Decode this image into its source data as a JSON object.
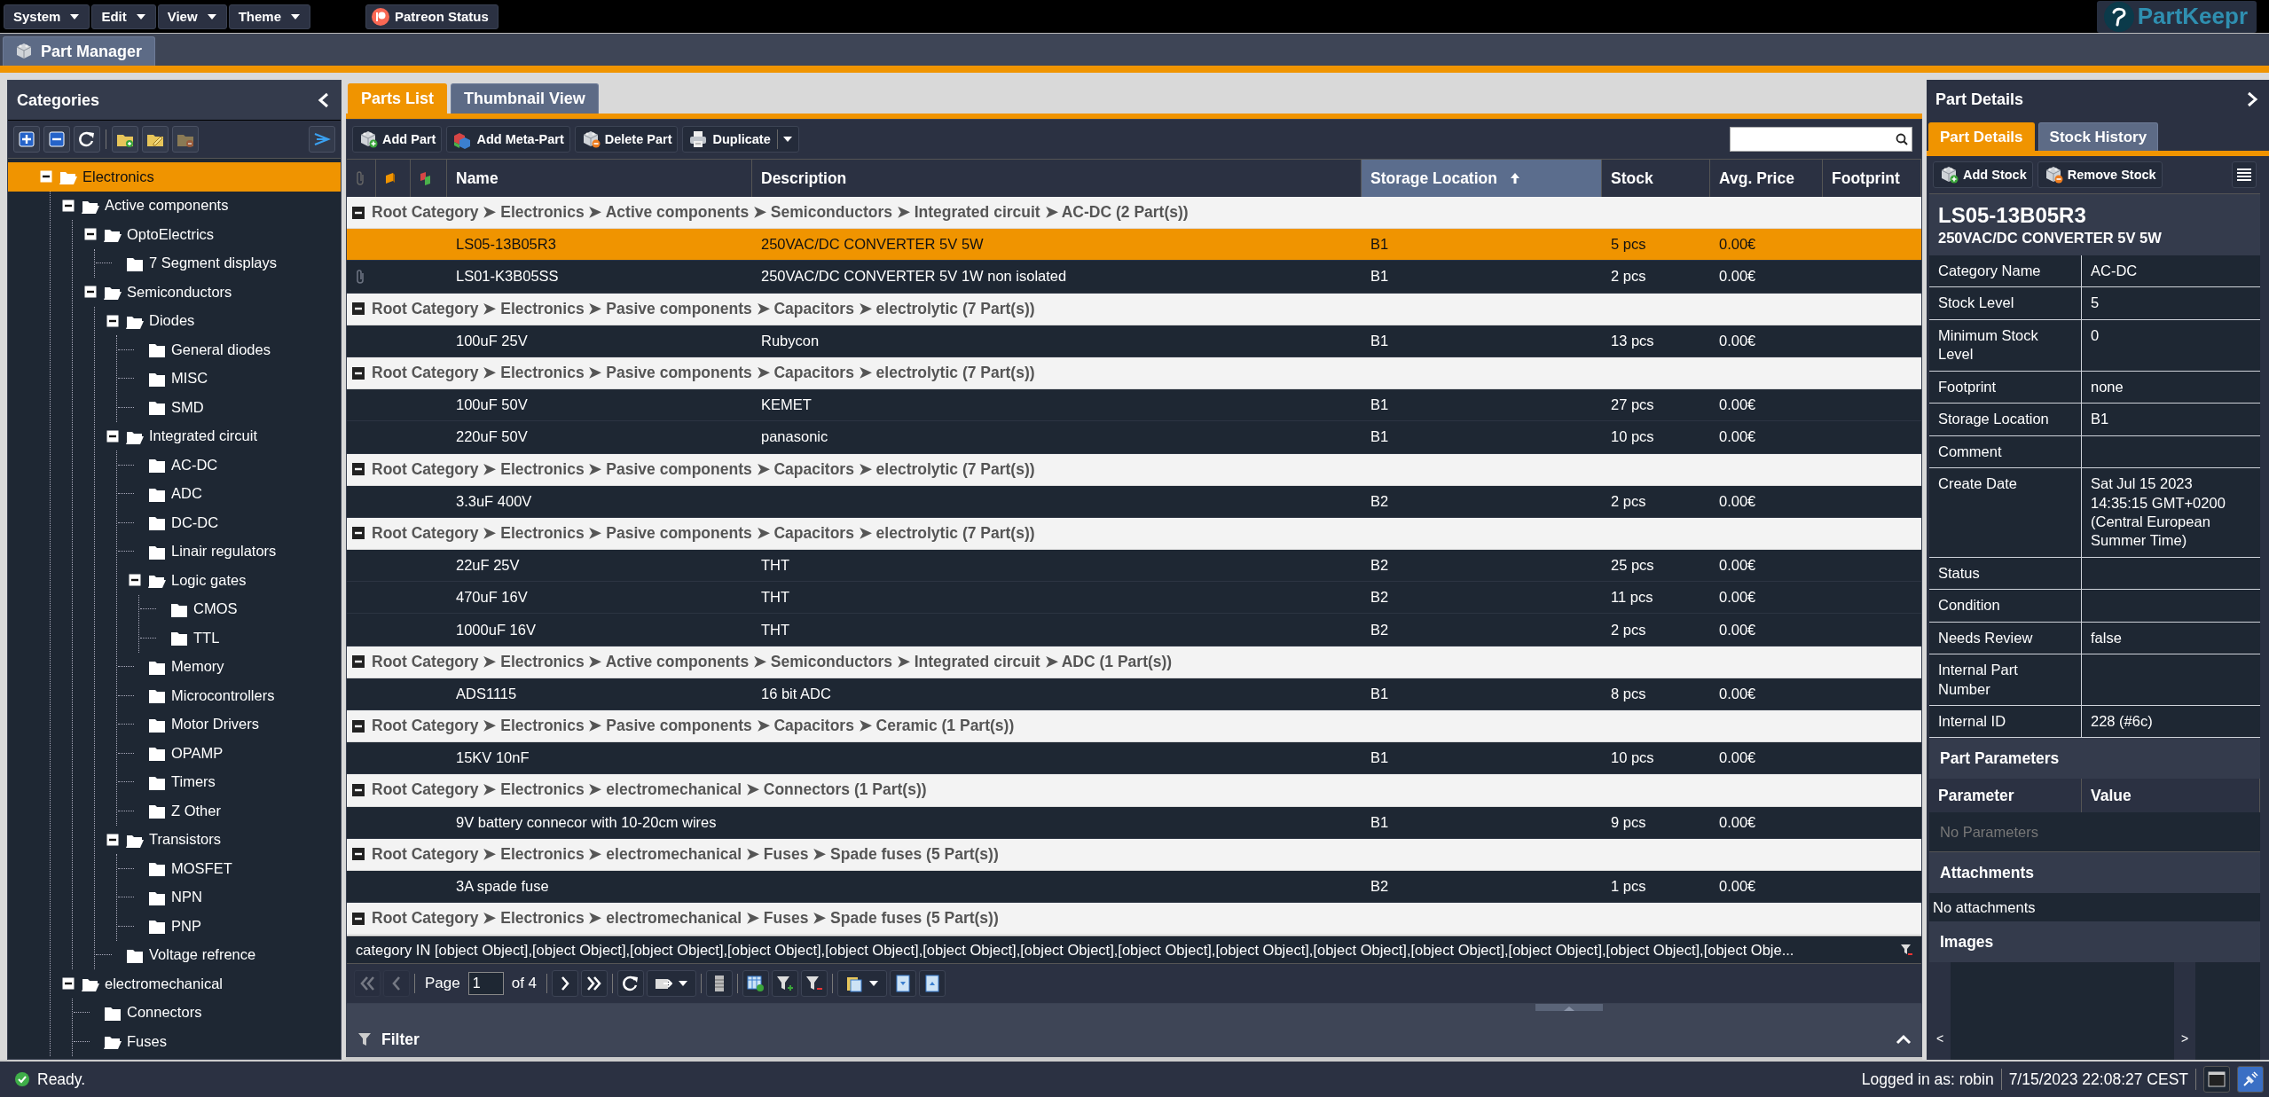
{
  "menus": [
    {
      "label": "System"
    },
    {
      "label": "Edit"
    },
    {
      "label": "View"
    },
    {
      "label": "Theme"
    }
  ],
  "patreon_button": "Patreon Status",
  "logo": "PartKeepr",
  "app_tabs": [
    {
      "label": "Part Manager",
      "selected": true
    }
  ],
  "categories": {
    "title": "Categories",
    "tree": [
      {
        "label": "Electronics",
        "selected": true,
        "expanded": true,
        "children": [
          {
            "label": "Active components",
            "selected": false,
            "expanded": true,
            "children": [
              {
                "label": "OptoElectrics",
                "selected": false,
                "expanded": true,
                "children": [
                  {
                    "label": "7 Segment displays",
                    "selected": false,
                    "expanded": false
                  }
                ]
              },
              {
                "label": "Semiconductors",
                "selected": false,
                "expanded": true,
                "children": [
                  {
                    "label": "Diodes",
                    "selected": false,
                    "expanded": true,
                    "children": [
                      {
                        "label": "General diodes",
                        "selected": false,
                        "expanded": false
                      },
                      {
                        "label": "MISC",
                        "selected": false,
                        "expanded": false
                      },
                      {
                        "label": "SMD",
                        "selected": false,
                        "expanded": false
                      }
                    ]
                  },
                  {
                    "label": "Integrated circuit",
                    "selected": false,
                    "expanded": true,
                    "children": [
                      {
                        "label": "AC-DC",
                        "selected": false,
                        "expanded": false
                      },
                      {
                        "label": "ADC",
                        "selected": false,
                        "expanded": false
                      },
                      {
                        "label": "DC-DC",
                        "selected": false,
                        "expanded": false
                      },
                      {
                        "label": "Linair regulators",
                        "selected": false,
                        "expanded": false
                      },
                      {
                        "label": "Logic gates",
                        "selected": false,
                        "expanded": true,
                        "children": [
                          {
                            "label": "CMOS",
                            "selected": false,
                            "expanded": false
                          },
                          {
                            "label": "TTL",
                            "selected": false,
                            "expanded": false
                          }
                        ]
                      },
                      {
                        "label": "Memory",
                        "selected": false,
                        "expanded": false
                      },
                      {
                        "label": "Microcontrollers",
                        "selected": false,
                        "expanded": false
                      },
                      {
                        "label": "Motor Drivers",
                        "selected": false,
                        "expanded": false
                      },
                      {
                        "label": "OPAMP",
                        "selected": false,
                        "expanded": false
                      },
                      {
                        "label": "Timers",
                        "selected": false,
                        "expanded": false
                      },
                      {
                        "label": "Z Other",
                        "selected": false,
                        "expanded": false
                      }
                    ]
                  },
                  {
                    "label": "Transistors",
                    "selected": false,
                    "expanded": true,
                    "children": [
                      {
                        "label": "MOSFET",
                        "selected": false,
                        "expanded": false
                      },
                      {
                        "label": "NPN",
                        "selected": false,
                        "expanded": false
                      },
                      {
                        "label": "PNP",
                        "selected": false,
                        "expanded": false
                      }
                    ]
                  },
                  {
                    "label": "Voltage refrence",
                    "selected": false,
                    "expanded": false
                  }
                ]
              }
            ]
          },
          {
            "label": "electromechanical",
            "selected": false,
            "expanded": true,
            "children": [
              {
                "label": "Connectors",
                "selected": false,
                "expanded": false
              },
              {
                "label": "Fuses",
                "selected": false,
                "expanded": true
              }
            ]
          }
        ]
      }
    ]
  },
  "parts": {
    "tabs": [
      {
        "label": "Parts List",
        "selected": true
      },
      {
        "label": "Thumbnail View",
        "selected": false
      }
    ],
    "toolbar": [
      {
        "kind": "add",
        "label": "Add Part"
      },
      {
        "kind": "meta",
        "label": "Add Meta-Part"
      },
      {
        "kind": "delete",
        "label": "Delete Part"
      },
      {
        "kind": "duplicate",
        "label": "Duplicate"
      }
    ],
    "columns": [
      {
        "kind": "attachment",
        "sorted": false
      },
      {
        "kind": "tag",
        "sorted": false
      },
      {
        "kind": "meta",
        "sorted": false
      },
      {
        "kind": "text",
        "label": "Name",
        "sorted": false
      },
      {
        "kind": "text",
        "label": "Description",
        "sorted": false
      },
      {
        "kind": "text",
        "label": "Storage Location",
        "sorted": true
      },
      {
        "kind": "text",
        "label": "Stock",
        "sorted": false
      },
      {
        "kind": "text",
        "label": "Avg. Price",
        "sorted": false
      },
      {
        "kind": "text",
        "label": "Footprint",
        "sorted": false
      }
    ],
    "rows": [
      {
        "kind": "group",
        "expanded": true,
        "text": "Root Category ➤ Electronics ➤ Active components ➤ Semiconductors ➤ Integrated circuit ➤ AC-DC (2 Part(s))"
      },
      {
        "kind": "part",
        "selected": true,
        "attachment": false,
        "name": "LS05-13B05R3",
        "description": "250VAC/DC CONVERTER 5V 5W",
        "storage_location": "B1",
        "stock": "5 pcs",
        "avg_price": "0.00€"
      },
      {
        "kind": "part",
        "selected": false,
        "attachment": true,
        "name": "LS01-K3B05SS",
        "description": "250VAC/DC CONVERTER 5V 1W non isolated",
        "storage_location": "B1",
        "stock": "2 pcs",
        "avg_price": "0.00€"
      },
      {
        "kind": "group",
        "expanded": true,
        "text": "Root Category ➤ Electronics ➤ Pasive components ➤ Capacitors ➤ electrolytic (7 Part(s))"
      },
      {
        "kind": "part",
        "selected": false,
        "attachment": false,
        "name": "100uF 25V",
        "description": "Rubycon",
        "storage_location": "B1",
        "stock": "13 pcs",
        "avg_price": "0.00€"
      },
      {
        "kind": "group",
        "expanded": true,
        "text": "Root Category ➤ Electronics ➤ Pasive components ➤ Capacitors ➤ electrolytic (7 Part(s))"
      },
      {
        "kind": "part",
        "selected": false,
        "attachment": false,
        "name": "100uF 50V",
        "description": "KEMET",
        "storage_location": "B1",
        "stock": "27 pcs",
        "avg_price": "0.00€"
      },
      {
        "kind": "part",
        "selected": false,
        "attachment": false,
        "name": "220uF 50V",
        "description": "panasonic",
        "storage_location": "B1",
        "stock": "10 pcs",
        "avg_price": "0.00€"
      },
      {
        "kind": "group",
        "expanded": true,
        "text": "Root Category ➤ Electronics ➤ Pasive components ➤ Capacitors ➤ electrolytic (7 Part(s))"
      },
      {
        "kind": "part",
        "selected": false,
        "attachment": false,
        "name": "3.3uF 400V",
        "storage_location": "B2",
        "stock": "2 pcs",
        "avg_price": "0.00€"
      },
      {
        "kind": "group",
        "expanded": true,
        "text": "Root Category ➤ Electronics ➤ Pasive components ➤ Capacitors ➤ electrolytic (7 Part(s))"
      },
      {
        "kind": "part",
        "selected": false,
        "attachment": false,
        "name": "22uF 25V",
        "description": "THT",
        "storage_location": "B2",
        "stock": "25 pcs",
        "avg_price": "0.00€"
      },
      {
        "kind": "part",
        "selected": false,
        "attachment": false,
        "name": "470uF 16V",
        "description": "THT",
        "storage_location": "B2",
        "stock": "11 pcs",
        "avg_price": "0.00€"
      },
      {
        "kind": "part",
        "selected": false,
        "attachment": false,
        "name": "1000uF 16V",
        "description": "THT",
        "storage_location": "B2",
        "stock": "2 pcs",
        "avg_price": "0.00€"
      },
      {
        "kind": "group",
        "expanded": true,
        "text": "Root Category ➤ Electronics ➤ Active components ➤ Semiconductors ➤ Integrated circuit ➤ ADC (1 Part(s))"
      },
      {
        "kind": "part",
        "selected": false,
        "attachment": false,
        "name": "ADS1115",
        "description": "16 bit ADC",
        "storage_location": "B1",
        "stock": "8 pcs",
        "avg_price": "0.00€"
      },
      {
        "kind": "group",
        "expanded": true,
        "text": "Root Category ➤ Electronics ➤ Pasive components ➤ Capacitors ➤ Ceramic (1 Part(s))"
      },
      {
        "kind": "part",
        "selected": false,
        "attachment": false,
        "name": "15KV 10nF",
        "storage_location": "B1",
        "stock": "10 pcs",
        "avg_price": "0.00€"
      },
      {
        "kind": "group",
        "expanded": true,
        "text": "Root Category ➤ Electronics ➤ electromechanical ➤ Connectors (1 Part(s))"
      },
      {
        "kind": "part",
        "selected": false,
        "attachment": false,
        "name": "9V battery connecor with 10-20cm wires",
        "storage_location": "B1",
        "stock": "9 pcs",
        "avg_price": "0.00€"
      },
      {
        "kind": "group",
        "expanded": true,
        "text": "Root Category ➤ Electronics ➤ electromechanical ➤ Fuses ➤ Spade fuses (5 Part(s))"
      },
      {
        "kind": "part",
        "selected": false,
        "attachment": false,
        "name": "3A spade fuse",
        "storage_location": "B2",
        "stock": "1 pcs",
        "avg_price": "0.00€"
      },
      {
        "kind": "group",
        "expanded": true,
        "text": "Root Category ➤ Electronics ➤ electromechanical ➤ Fuses ➤ Spade fuses (5 Part(s))"
      }
    ],
    "filter_summary": "category IN [object Object],[object Object],[object Object],[object Object],[object Object],[object Object],[object Object],[object Object],[object Object],[object Object],[object Object],[object Object],[object Object],[object Obje...",
    "paging": {
      "back_disabled": true,
      "page_label": "Page",
      "page": "1",
      "of": "of 4"
    },
    "filter_panel": "Filter"
  },
  "details": {
    "title": "Part Details",
    "tabs": [
      {
        "label": "Part Details",
        "selected": true
      },
      {
        "label": "Stock History",
        "selected": false
      }
    ],
    "toolbar": [
      {
        "kind": "add",
        "label": "Add Stock"
      },
      {
        "kind": "delete",
        "label": "Remove Stock"
      }
    ],
    "part_name": "LS05-13B05R3",
    "part_description": "250VAC/DC CONVERTER 5V 5W",
    "properties": [
      {
        "label": "Category Name",
        "value": "AC-DC"
      },
      {
        "label": "Stock Level",
        "value": "5"
      },
      {
        "label": "Minimum Stock Level",
        "value": "0"
      },
      {
        "label": "Footprint",
        "value": "none"
      },
      {
        "label": "Storage Location",
        "value": "B1"
      },
      {
        "label": "Comment"
      },
      {
        "label": "Create Date",
        "value": "Sat Jul 15 2023 14:35:15 GMT+0200 (Central European Summer Time)"
      },
      {
        "label": "Status"
      },
      {
        "label": "Condition"
      },
      {
        "label": "Needs Review",
        "value": "false"
      },
      {
        "label": "Internal Part Number"
      },
      {
        "label": "Internal ID",
        "value": "228 (#6c)"
      }
    ],
    "parameters_title": "Part Parameters",
    "parameter_columns": [
      "Parameter",
      "Value"
    ],
    "parameters_empty": "No Parameters",
    "attachments_title": "Attachments",
    "attachments_empty": "No attachments",
    "images_title": "Images",
    "images_prev": "<",
    "images_next": ">"
  },
  "status": {
    "message": "Ready.",
    "user": "Logged in as: robin",
    "time": "7/15/2023 22:08:27 CEST"
  }
}
